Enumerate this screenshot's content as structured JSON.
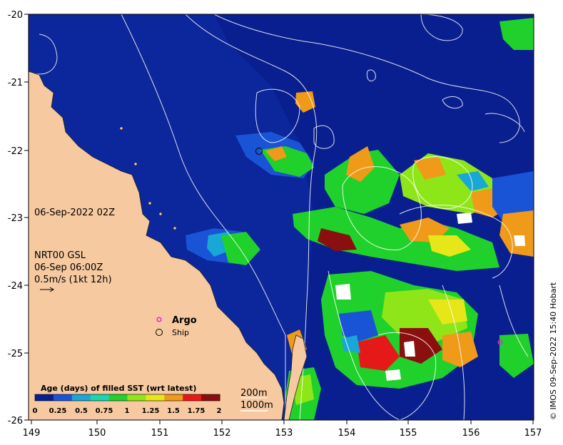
{
  "map": {
    "lat_ticks": [
      "-20",
      "-21",
      "-22",
      "-23",
      "-24",
      "-25",
      "-26"
    ],
    "lon_ticks": [
      "149",
      "150",
      "151",
      "152",
      "153",
      "154",
      "155",
      "156",
      "157"
    ],
    "lat_range": [
      -26,
      -20
    ],
    "lon_range": [
      149,
      157
    ],
    "colors": {
      "ocean": "#0a1f8f",
      "land": "#f7c9a0",
      "contour": "#ffffff"
    }
  },
  "annotations": {
    "date": "06-Sep-2022 02Z",
    "current_line1": "NRT00 GSL",
    "current_line2": "06-Sep 06:00Z",
    "current_line3": "0.5m/s (1kt 12h)",
    "argo_label": "Argo",
    "ship_label": "Ship",
    "bath_200": "200m",
    "bath_1000": "1000m",
    "copyright": "© IMOS 09-Sep-2022 15:40 Hobart"
  },
  "colorbar": {
    "title": "Age (days) of filled SST (wrt latest)",
    "tick_labels": [
      "0",
      "0.25",
      "0.5",
      "0.75",
      "1",
      "1.25",
      "1.5",
      "1.75",
      "2"
    ],
    "colors": [
      "#0a1f8f",
      "#1a54d6",
      "#19a7d6",
      "#19d6b0",
      "#1fd12a",
      "#8ee619",
      "#e6e619",
      "#f09a19",
      "#e61919",
      "#8b0f0f"
    ]
  }
}
